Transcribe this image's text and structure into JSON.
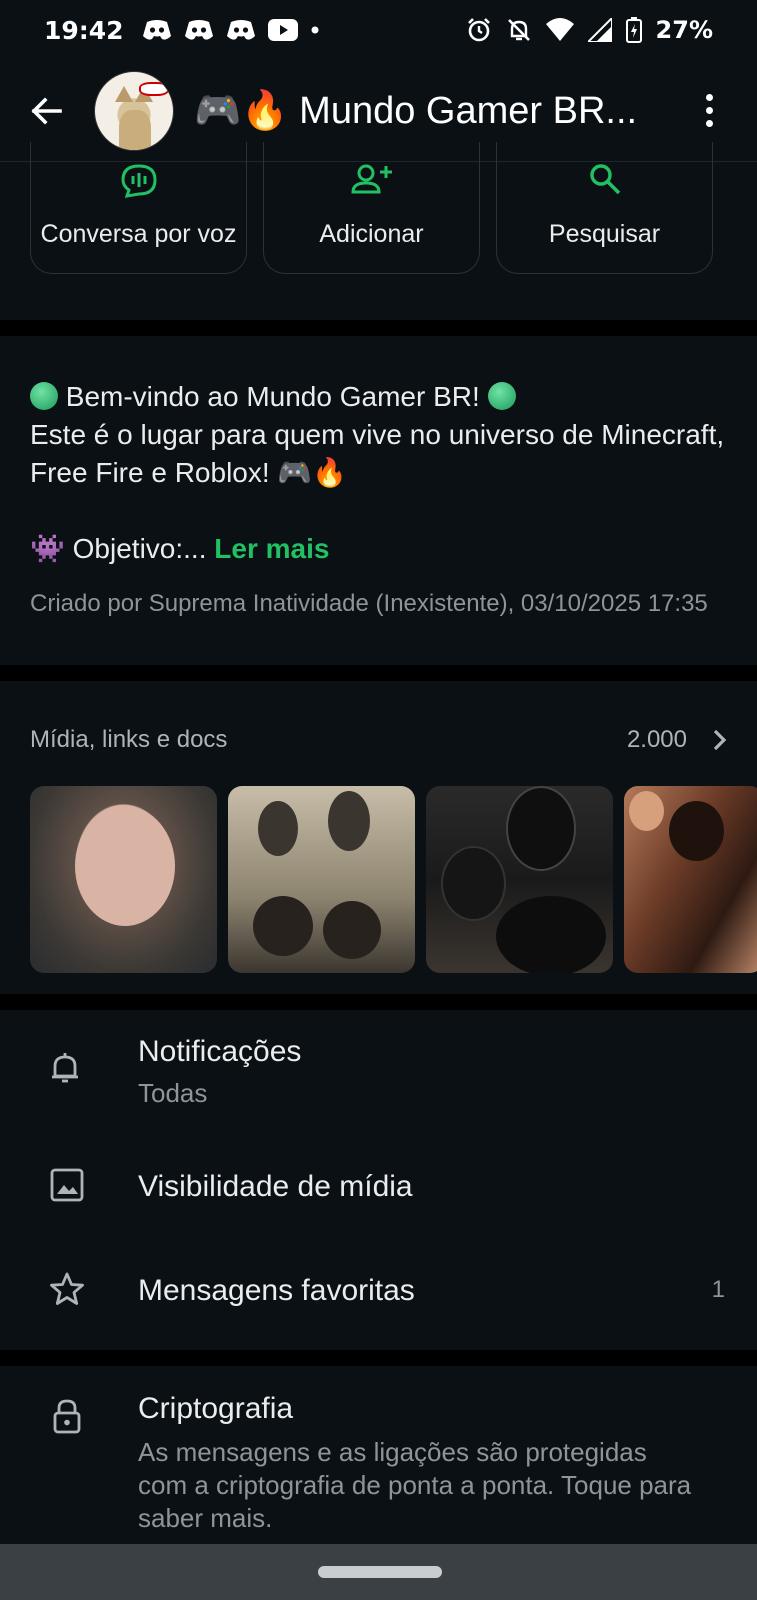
{
  "status_bar": {
    "time": "19:42",
    "battery": "27%",
    "left_icons": [
      "discord-icon",
      "discord-icon",
      "discord-icon",
      "youtube-icon",
      "dot-icon"
    ],
    "right_icons": [
      "alarm-icon",
      "notifications-off-icon",
      "wifi-icon",
      "signal-icon",
      "battery-charging-icon"
    ]
  },
  "app_bar": {
    "title": "🎮🔥 Mundo Gamer BR..."
  },
  "actions": [
    {
      "label": "Conversa por voz",
      "icon": "voice-chat-icon"
    },
    {
      "label": "Adicionar",
      "icon": "add-person-icon"
    },
    {
      "label": "Pesquisar",
      "icon": "search-icon"
    }
  ],
  "description": {
    "line1": "Bem-vindo ao Mundo Gamer BR!",
    "line2": "Este é o lugar para quem vive no universo de Minecraft, Free Fire e Roblox! 🎮🔥",
    "objective_emoji": "👾",
    "objective": "Objetivo:...",
    "read_more": "Ler mais",
    "created": "Criado por Suprema Inatividade (Inexistente), 03/10/2025 17:35"
  },
  "media": {
    "title": "Mídia, links e docs",
    "count": "2.000"
  },
  "settings": {
    "notifications": {
      "title": "Notificações",
      "subtitle": "Todas"
    },
    "media_visibility": {
      "title": "Visibilidade de mídia"
    },
    "starred": {
      "title": "Mensagens favoritas",
      "count": "1"
    }
  },
  "encryption": {
    "title": "Criptografia",
    "subtitle": "As mensagens e as ligações são protegidas com a criptografia de ponta a ponta. Toque para saber mais."
  },
  "colors": {
    "background": "#0b1014",
    "accent": "#21c063",
    "text": "#e9edef",
    "muted": "#8d9599"
  }
}
